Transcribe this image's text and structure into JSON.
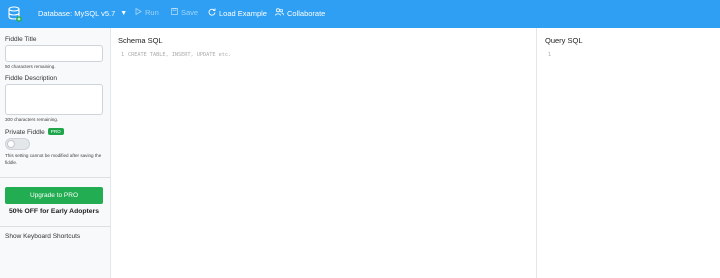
{
  "topbar": {
    "database_label": "Database: MySQL v5.7",
    "caret": "▼",
    "run_label": "Run",
    "save_label": "Save",
    "load_example_label": "Load Example",
    "collaborate_label": "Collaborate",
    "icons": {
      "logo": "database-icon",
      "run": "play-icon",
      "save": "save-icon",
      "load": "refresh-icon",
      "collaborate": "users-icon"
    },
    "bg_color": "#2e9ff2"
  },
  "sidebar": {
    "title_label": "Fiddle Title",
    "title_value": "",
    "title_help": "50 characters remaining.",
    "description_label": "Fiddle Description",
    "description_value": "",
    "description_help": "300 characters remaining.",
    "private_label": "Private Fiddle",
    "pro_badge": "PRO",
    "private_help": "This setting cannot be modified after saving the fiddle.",
    "upgrade_button": "Upgrade to PRO",
    "offer_text": "50% OFF for Early Adopters",
    "shortcuts_link": "Show Keyboard Shortcuts",
    "upgrade_color": "#22ad53"
  },
  "schema": {
    "title": "Schema SQL",
    "line_number": "1",
    "placeholder": "CREATE TABLE, INSERT, UPDATE etc."
  },
  "query": {
    "title": "Query SQL",
    "line_number": "1"
  }
}
